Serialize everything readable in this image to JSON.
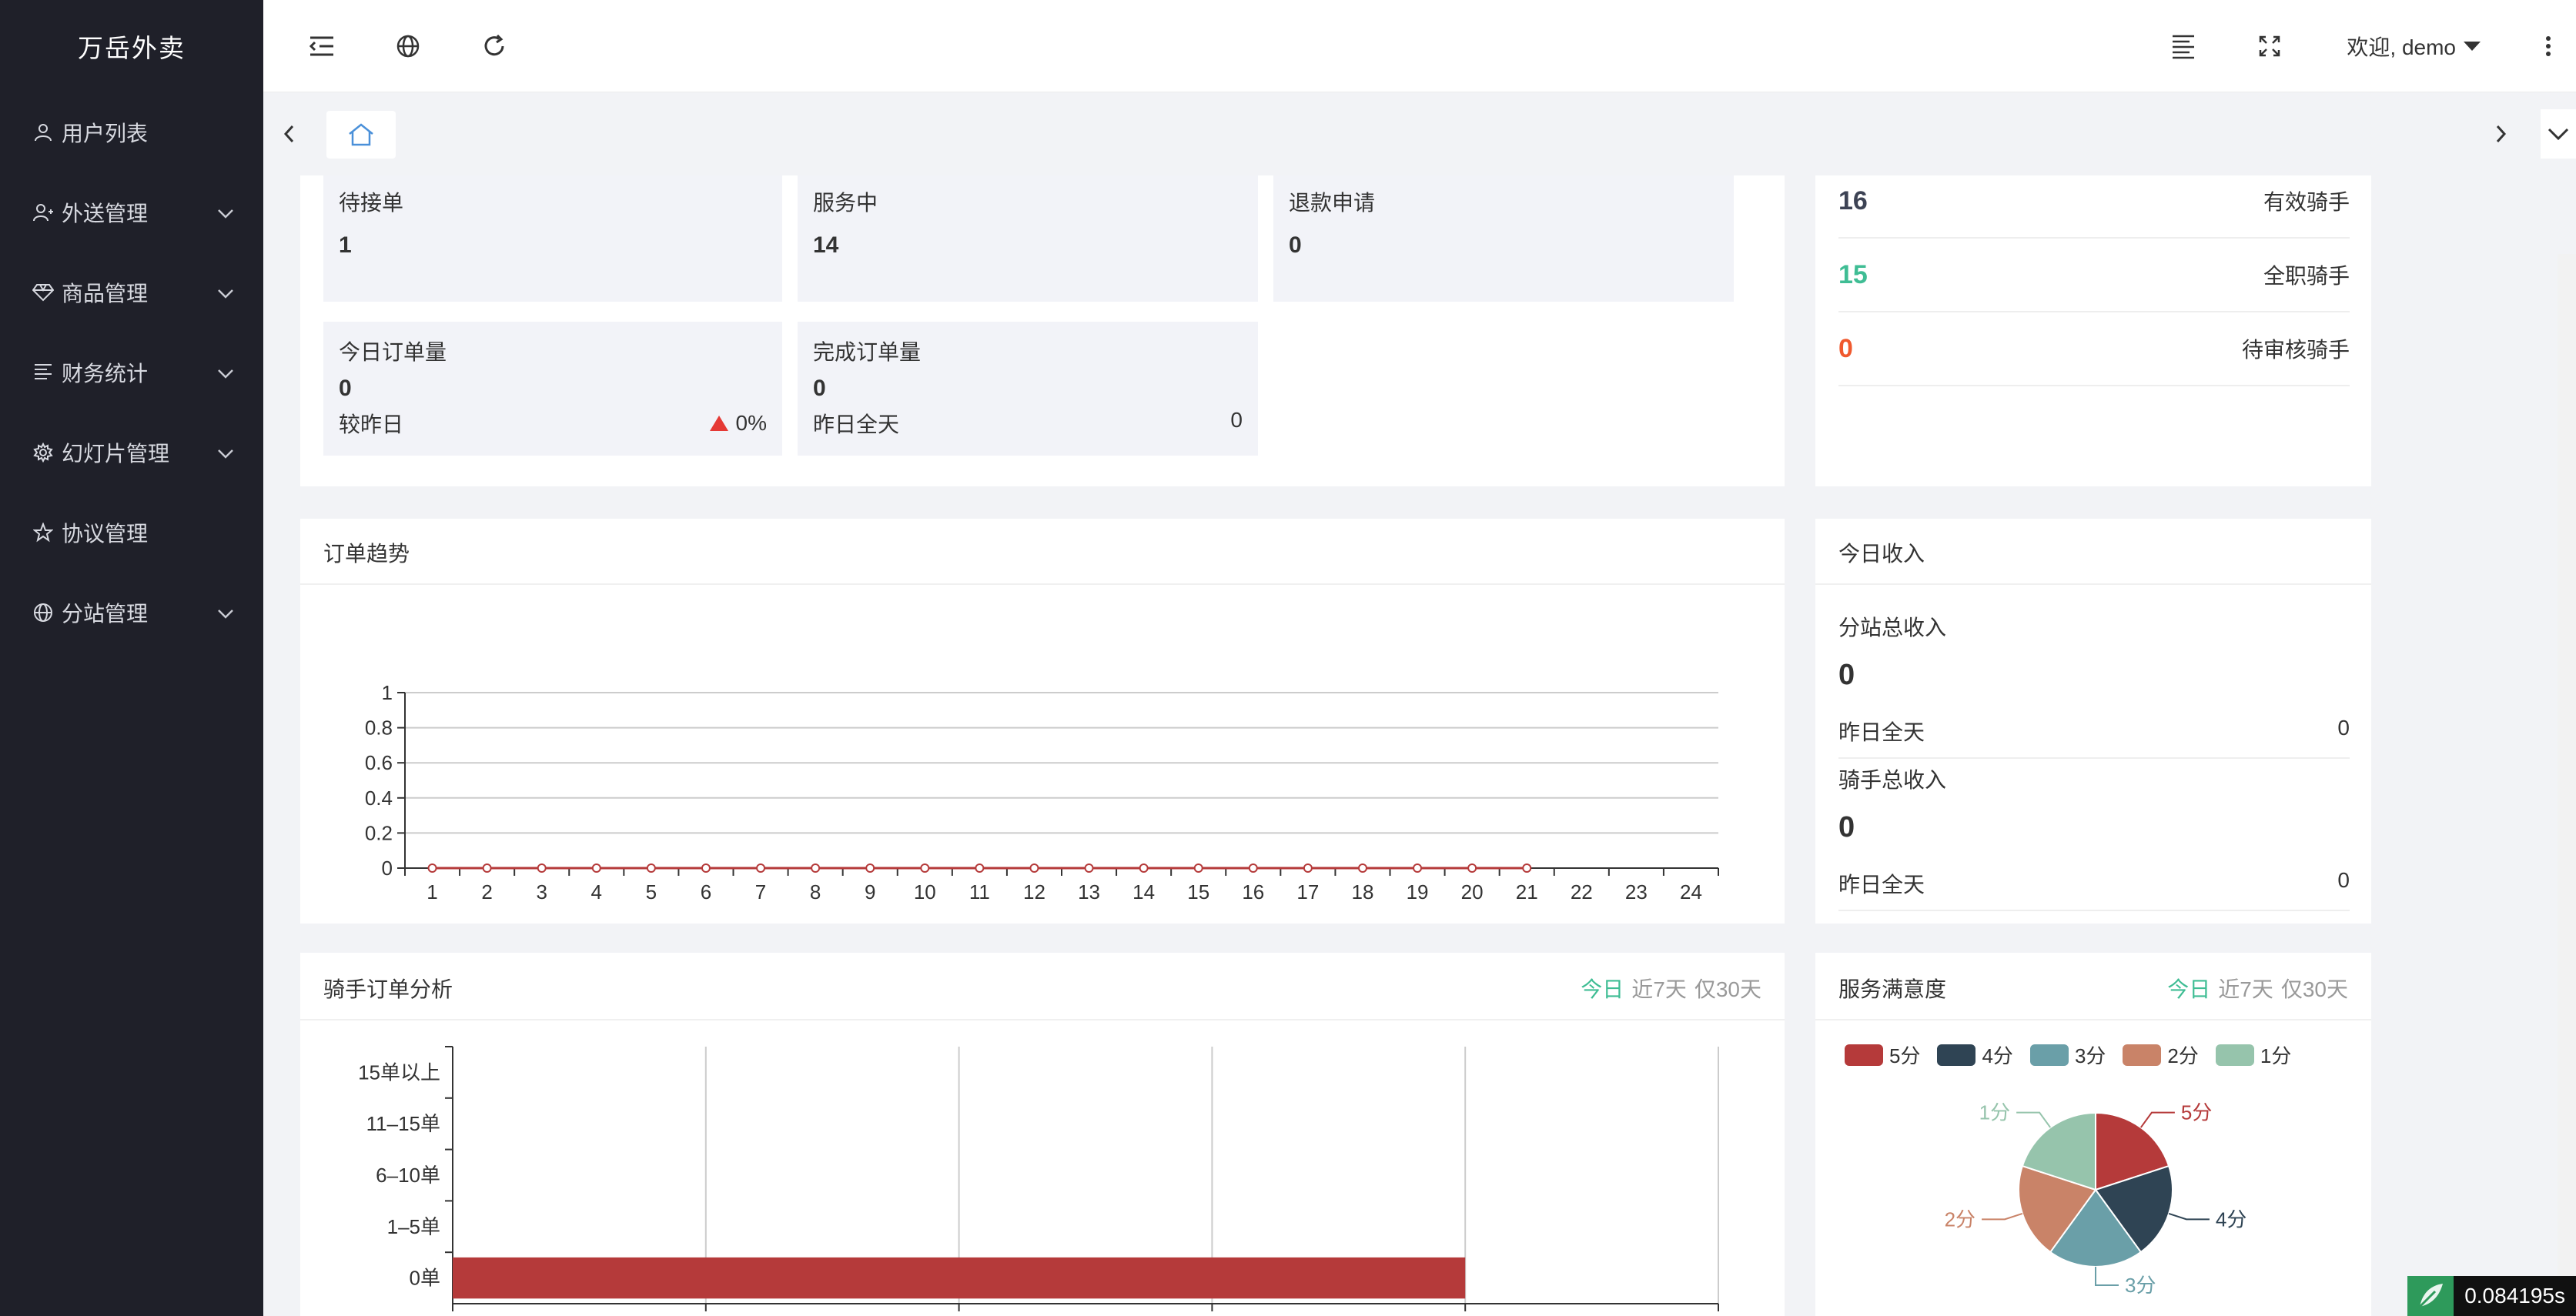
{
  "app": {
    "title": "万岳外卖"
  },
  "sidebar": {
    "items": [
      {
        "label": "用户列表",
        "icon": "user-icon",
        "expandable": false
      },
      {
        "label": "外送管理",
        "icon": "delivery-user-icon",
        "expandable": true
      },
      {
        "label": "商品管理",
        "icon": "diamond-icon",
        "expandable": true
      },
      {
        "label": "财务统计",
        "icon": "list-lines-icon",
        "expandable": true
      },
      {
        "label": "幻灯片管理",
        "icon": "gear-icon",
        "expandable": true
      },
      {
        "label": "协议管理",
        "icon": "star-icon",
        "expandable": false
      },
      {
        "label": "分站管理",
        "icon": "globe-icon",
        "expandable": true
      }
    ]
  },
  "topbar": {
    "welcome": "欢迎, demo"
  },
  "order_stats": {
    "pending": {
      "label": "待接单",
      "value": "1"
    },
    "serving": {
      "label": "服务中",
      "value": "14"
    },
    "refund": {
      "label": "退款申请",
      "value": "0"
    },
    "today_orders": {
      "label": "今日订单量",
      "value": "0",
      "compare_label": "较昨日",
      "compare_value": "0%"
    },
    "completed": {
      "label": "完成订单量",
      "value": "0",
      "sub_label": "昨日全天",
      "sub_value": "0"
    }
  },
  "riders": [
    {
      "count": "16",
      "label": "有效骑手",
      "color": "#3d4354"
    },
    {
      "count": "15",
      "label": "全职骑手",
      "color": "#3fbd94"
    },
    {
      "count": "0",
      "label": "待审核骑手",
      "color": "#f0592e"
    }
  ],
  "trend": {
    "title": "订单趋势",
    "chart_data": {
      "type": "line",
      "x": [
        "1",
        "2",
        "3",
        "4",
        "5",
        "6",
        "7",
        "8",
        "9",
        "10",
        "11",
        "12",
        "13",
        "14",
        "15",
        "16",
        "17",
        "18",
        "19",
        "20",
        "21",
        "22",
        "23",
        "24"
      ],
      "series": [
        {
          "values": [
            0,
            0,
            0,
            0,
            0,
            0,
            0,
            0,
            0,
            0,
            0,
            0,
            0,
            0,
            0,
            0,
            0,
            0,
            0,
            0,
            0
          ]
        }
      ],
      "yticks": [
        "0",
        "0.2",
        "0.4",
        "0.6",
        "0.8",
        "1"
      ],
      "ylim": [
        0,
        1
      ],
      "grid": true,
      "color": "#b53a3a"
    }
  },
  "income": {
    "title": "今日收入",
    "branch": {
      "label": "分站总收入",
      "value": "0",
      "sub_label": "昨日全天",
      "sub_value": "0"
    },
    "rider": {
      "label": "骑手总收入",
      "value": "0",
      "sub_label": "昨日全天",
      "sub_value": "0"
    }
  },
  "rider_analysis": {
    "title": "骑手订单分析",
    "filters": [
      "今日",
      "近7天",
      "仅30天"
    ],
    "chart_data": {
      "type": "bar",
      "orientation": "horizontal",
      "categories": [
        "0单",
        "1–5单",
        "6–10单",
        "11–15单",
        "15单以上"
      ],
      "values": [
        16,
        0,
        0,
        0,
        0
      ],
      "xlim": [
        0,
        20
      ],
      "color": "#b53a3a"
    }
  },
  "satisfaction": {
    "title": "服务满意度",
    "filters": [
      "今日",
      "近7天",
      "仅30天"
    ],
    "chart_data": {
      "type": "pie",
      "labels": [
        "5分",
        "4分",
        "3分",
        "2分",
        "1分"
      ],
      "values": [
        1,
        1,
        1,
        1,
        1
      ],
      "colors": [
        "#b53a3a",
        "#2f4454",
        "#6a9fa8",
        "#c98368",
        "#96c4ac"
      ]
    }
  },
  "timer": {
    "value": "0.084195s"
  }
}
